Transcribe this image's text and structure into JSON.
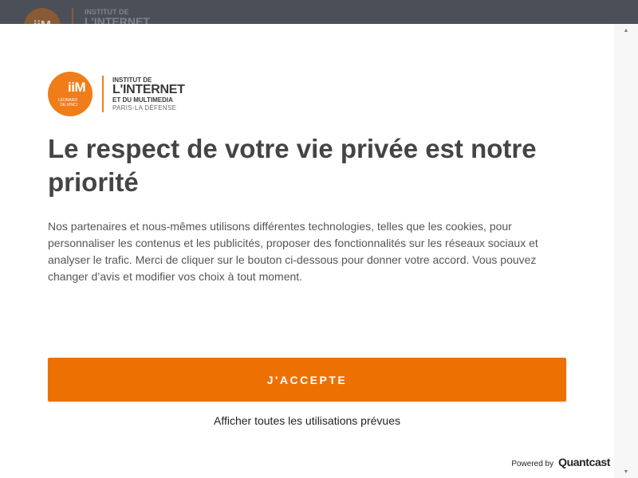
{
  "background_header": {
    "logo_mark": "iiM",
    "logo_line1": "INSTITUT DE",
    "logo_line2": "L'INTERNET"
  },
  "consent": {
    "logo": {
      "mark": "iiM",
      "sub": "LÉONARD DE VINCI",
      "line1": "INSTITUT DE",
      "line2": "L'INTERNET",
      "line3": "ET DU MULTIMEDIA",
      "line4": "PARIS-LA DÉFENSE"
    },
    "title": "Le respect de votre vie privée est notre priorité",
    "description": "Nos partenaires et nous-mêmes utilisons différentes technologies, telles que les cookies, pour personnaliser les contenus et les publicités, proposer des fonctionnalités sur les réseaux sociaux et analyser le trafic. Merci de cliquer sur le bouton ci-dessous pour donner votre accord. Vous pouvez changer d’avis et modifier vos choix à tout moment.",
    "accept_label": "J'ACCEPTE",
    "show_all_label": "Afficher toutes les utilisations prévues",
    "powered_by": "Powered by",
    "powered_brand": "Quantcast"
  },
  "scrollbar": {
    "up_icon": "triangle-up-icon",
    "down_icon": "triangle-down-icon"
  },
  "colors": {
    "accent": "#ed7102",
    "logo_orange": "#ef7d1a",
    "overlay": "#4a4f58",
    "title_text": "#444444"
  }
}
